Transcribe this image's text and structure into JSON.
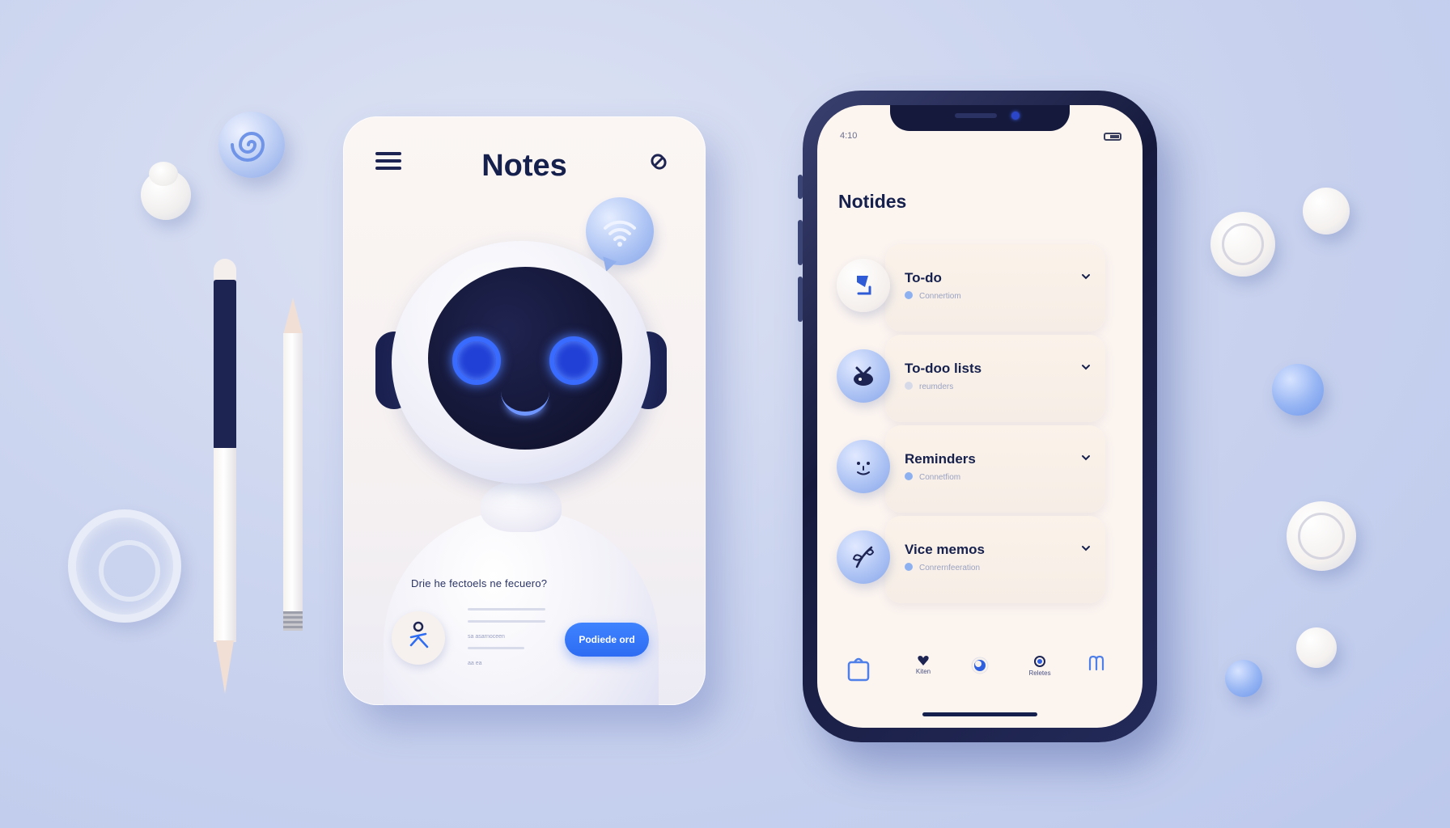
{
  "left_card": {
    "title": "Notes",
    "question": "Drie he fectoels ne fecuero?",
    "button_label": "Podiede ord",
    "meta_lines": [
      "sa asarnoceen",
      "aa ea"
    ],
    "icons": [
      "menu-icon",
      "link-icon",
      "wifi-icon"
    ]
  },
  "phone": {
    "status_time": "4:10",
    "title": "Notides",
    "items": [
      {
        "title": "To-do",
        "subtitle": "Connertiom",
        "icon": "document-icon"
      },
      {
        "title": "To-doo lists",
        "subtitle": "reumders",
        "icon": "bird-icon"
      },
      {
        "title": "Reminders",
        "subtitle": "Connetfiom",
        "icon": "face-icon"
      },
      {
        "title": "Vice memos",
        "subtitle": "Conrernfeeration",
        "icon": "leaf-icon"
      }
    ],
    "tabs": [
      {
        "label": "",
        "icon": "bag-icon"
      },
      {
        "label": "Kiten",
        "icon": "heart-icon"
      },
      {
        "label": "",
        "icon": "circle-icon"
      },
      {
        "label": "Reletes",
        "icon": "dot-icon"
      },
      {
        "label": "",
        "icon": "m-icon"
      }
    ]
  },
  "colors": {
    "background": "#ccd5ef",
    "accent": "#2d6cf3",
    "navy": "#16204d",
    "card": "#fbf6f3"
  }
}
